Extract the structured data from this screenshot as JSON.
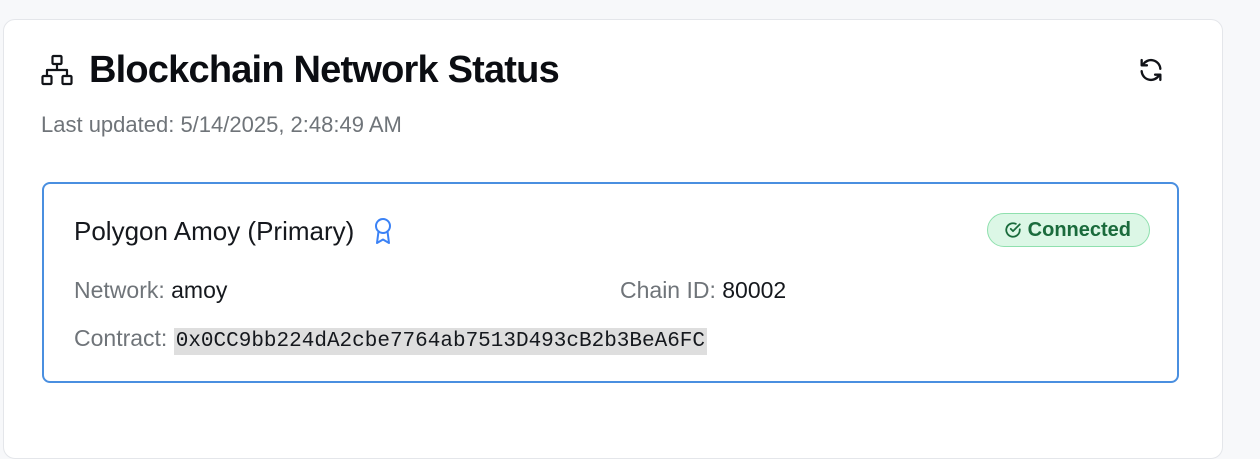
{
  "header": {
    "title": "Blockchain Network Status",
    "title_icon": "network-icon",
    "refresh_icon": "refresh-icon",
    "last_updated": "Last updated: 5/14/2025, 2:48:49 AM"
  },
  "network": {
    "name": "Polygon Amoy (Primary)",
    "primary_icon": "award-icon",
    "status": "Connected",
    "status_icon": "check-circle-icon",
    "network_label": "Network:",
    "network_value": "amoy",
    "chain_label": "Chain ID:",
    "chain_value": "80002",
    "contract_label": "Contract:",
    "contract_value": "0x0CC9bb224dA2cbe7764ab7513D493cB2b3BeA6FC"
  },
  "colors": {
    "accent_border": "#4a8fe0",
    "status_bg": "#dcf7e6",
    "status_text": "#1a6b3c",
    "icon_blue": "#3b82f6"
  }
}
